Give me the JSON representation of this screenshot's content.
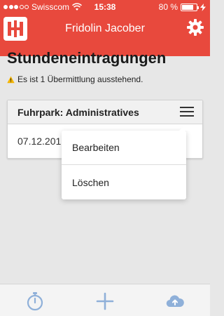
{
  "status_bar": {
    "carrier": "Swisscom",
    "time": "15:38",
    "battery": "80 %",
    "battery_level": 0.8
  },
  "header": {
    "title": "Fridolin Jacober"
  },
  "page": {
    "heading": "Stundeneintragungen",
    "notice": "Es ist 1 Übermittlung ausstehend."
  },
  "card": {
    "title": "Fuhrpark: Administratives",
    "date": "07.12.201"
  },
  "menu": {
    "items": [
      "Bearbeiten",
      "Löschen"
    ]
  },
  "tabbar": {
    "icons": [
      "stopwatch-icon",
      "plus-icon",
      "cloud-upload-icon"
    ]
  },
  "colors": {
    "accent": "#e8493d",
    "tab_icon": "#8fb0d9"
  }
}
